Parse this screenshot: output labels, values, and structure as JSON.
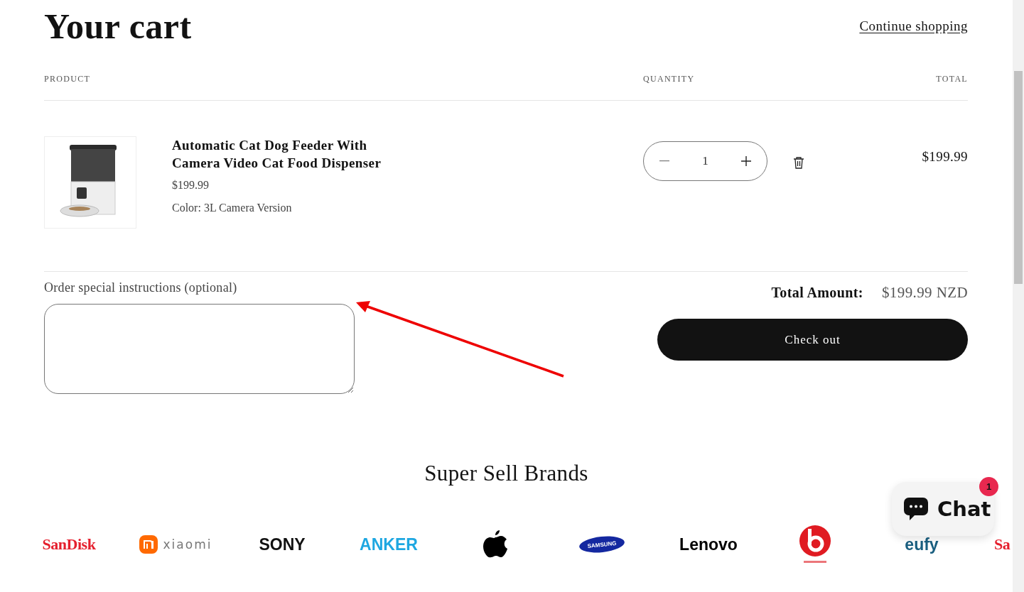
{
  "header": {
    "title": "Your cart",
    "continue_link": "Continue shopping"
  },
  "table": {
    "columns": [
      "PRODUCT",
      "QUANTITY",
      "TOTAL"
    ],
    "rows": [
      {
        "name": "Automatic Cat Dog Feeder With Camera Video Cat Food Dispenser",
        "price": "$199.99",
        "option": "Color: 3L Camera Version",
        "quantity": "1",
        "total": "$199.99"
      }
    ]
  },
  "instructions": {
    "label": "Order special instructions (optional)"
  },
  "summary": {
    "label": "Total Amount:",
    "amount": "$199.99 NZD",
    "checkout": "Check out"
  },
  "brands": {
    "title": "Super Sell Brands",
    "items": [
      {
        "kind": "wordmark",
        "label": "SanDisk",
        "color": "#e5202e"
      },
      {
        "kind": "xiaomi",
        "label": "xiaomi",
        "color": "#ff6900"
      },
      {
        "kind": "wordmark",
        "label": "SONY",
        "color": "#111111"
      },
      {
        "kind": "wordmark",
        "label": "ANKER",
        "color": "#1ea7e1"
      },
      {
        "kind": "apple",
        "color": "#000000"
      },
      {
        "kind": "samsung",
        "label": "SAMSUNG",
        "color": "#1428a0"
      },
      {
        "kind": "wordmark",
        "label": "Lenovo",
        "color": "#000000"
      },
      {
        "kind": "beats",
        "color": "#e01b22"
      },
      {
        "kind": "wordmark",
        "label": "eufy",
        "color": "#1a5f80"
      },
      {
        "kind": "wordmark",
        "label": "Sa",
        "color": "#e5202e"
      }
    ]
  },
  "chat": {
    "label": "Chat",
    "badge": "1"
  }
}
